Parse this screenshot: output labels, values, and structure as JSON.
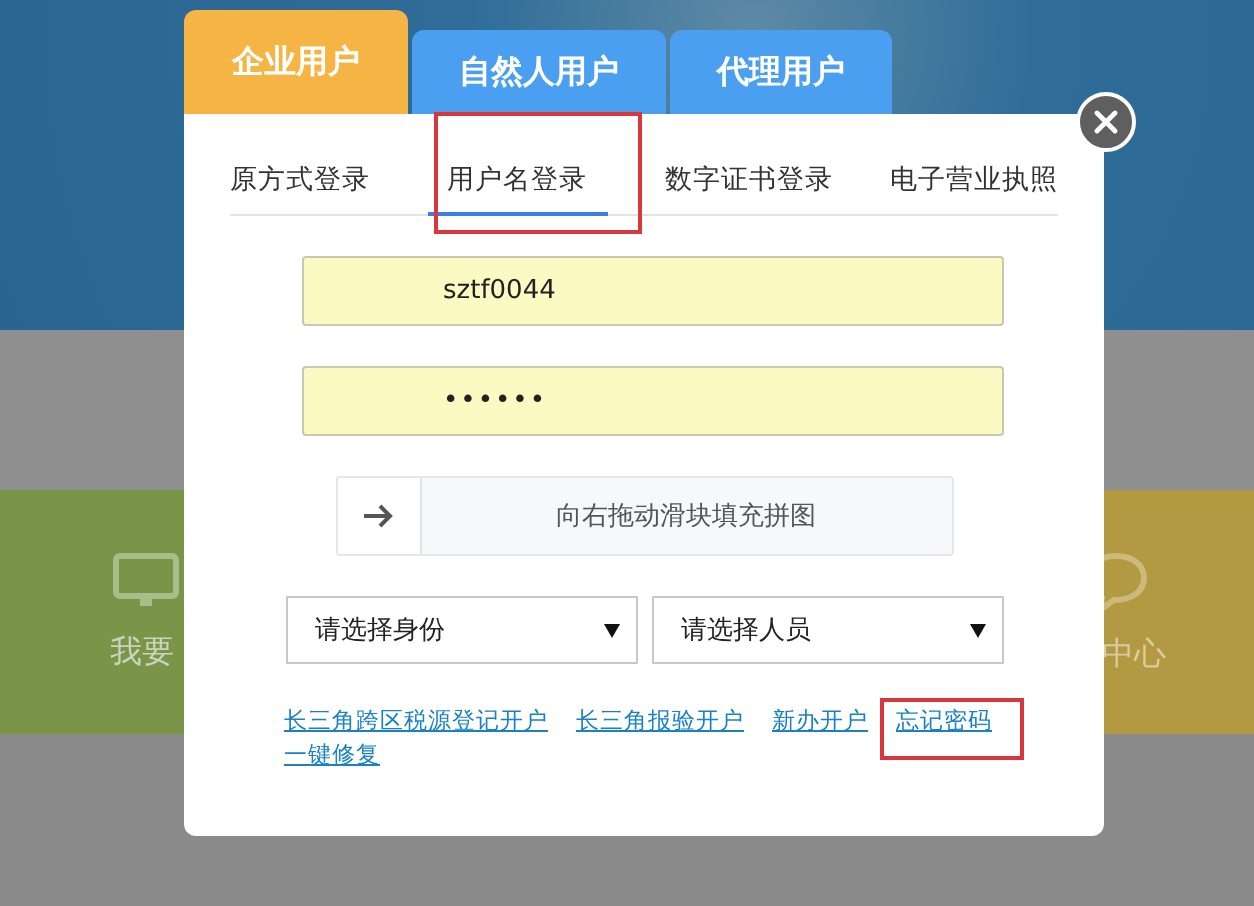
{
  "background": {
    "texts": [
      "我要",
      "中心"
    ]
  },
  "account_tabs": [
    {
      "label": "企业用户",
      "selected": true
    },
    {
      "label": "自然人用户",
      "selected": false
    },
    {
      "label": "代理用户",
      "selected": false
    }
  ],
  "login_tabs": [
    {
      "label": "原方式登录",
      "selected": false
    },
    {
      "label": "用户名登录",
      "selected": true
    },
    {
      "label": "数字证书登录",
      "selected": false
    },
    {
      "label": "电子营业执照",
      "selected": false
    }
  ],
  "form": {
    "username": {
      "value": "sztf0044"
    },
    "password": {
      "value": "••••••"
    },
    "slider": {
      "label": "向右拖动滑块填充拼图"
    },
    "selects": [
      {
        "value": "请选择身份"
      },
      {
        "value": "请选择人员"
      }
    ]
  },
  "links": [
    "长三角跨区税源登记开户",
    "长三角报验开户",
    "新办开户",
    "忘记密码",
    "一键修复"
  ]
}
